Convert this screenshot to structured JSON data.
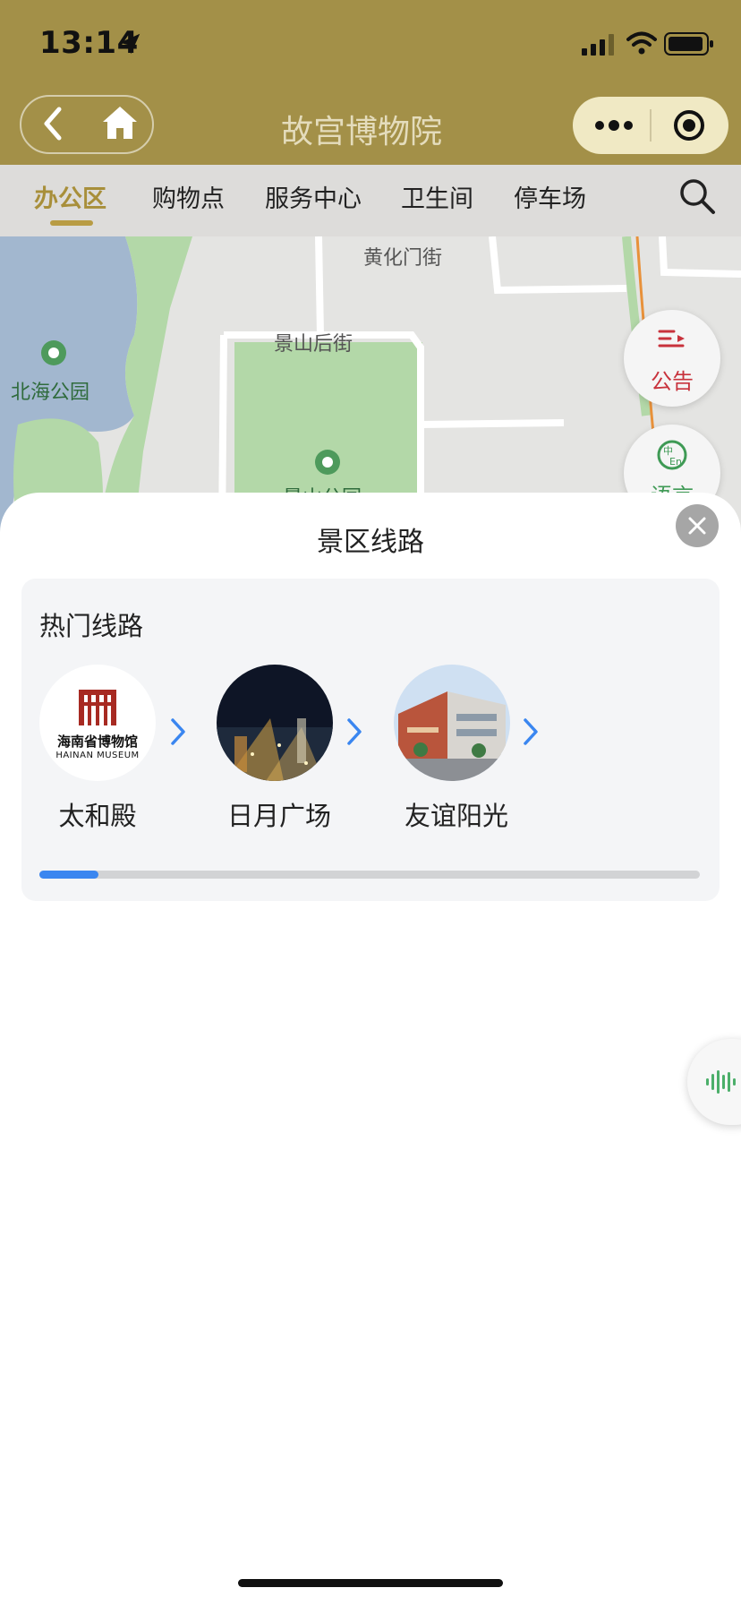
{
  "status_bar": {
    "time": "13:14"
  },
  "header": {
    "title": "故宫博物院"
  },
  "tabs": [
    {
      "label": "办公区",
      "active": true
    },
    {
      "label": "购物点",
      "active": false
    },
    {
      "label": "服务中心",
      "active": false
    },
    {
      "label": "卫生间",
      "active": false
    },
    {
      "label": "停车场",
      "active": false
    }
  ],
  "map": {
    "labels": {
      "street_top": "黄化门街",
      "street_mid": "景山后街",
      "park_left": "北海公园",
      "park_center": "景山公园"
    },
    "notice_button": "公告",
    "language_button": "语言"
  },
  "sheet": {
    "title": "景区线路",
    "section_title": "热门线路",
    "routes": [
      {
        "label": "太和殿",
        "logo_cn": "海南省博物馆",
        "logo_en": "HAINAN MUSEUM"
      },
      {
        "label": "日月广场"
      },
      {
        "label": "友谊阳光"
      }
    ],
    "scroll_progress": 0.09
  },
  "colors": {
    "header_bg": "#a39048",
    "accent_gold": "#b89c44",
    "notice_red": "#c8323c",
    "language_green": "#3f9a55",
    "progress_blue": "#3a86f0",
    "chevron_blue": "#3a86f0"
  }
}
